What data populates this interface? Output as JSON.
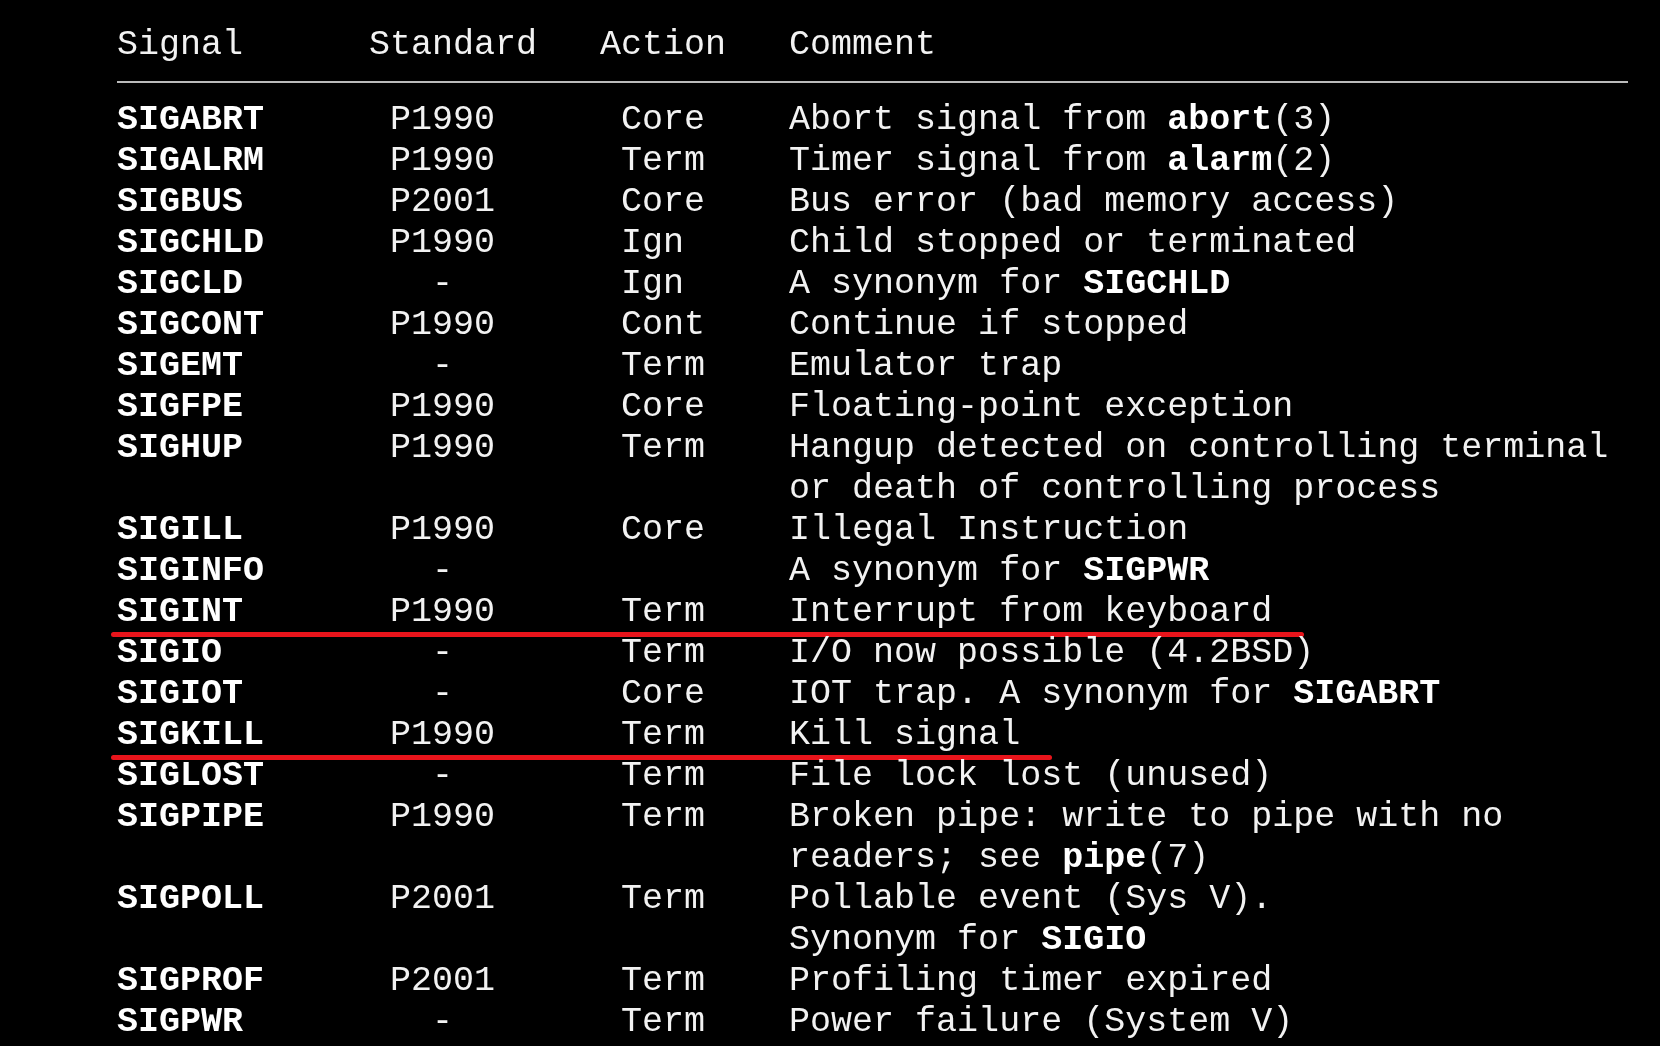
{
  "table": {
    "columns": [
      "Signal",
      "Standard",
      "Action",
      "Comment"
    ],
    "rows": [
      {
        "signal": "SIGABRT",
        "standard": "P1990",
        "action": "Core",
        "comment": [
          "Abort signal from **abort**(3)"
        ],
        "red_underline": false
      },
      {
        "signal": "SIGALRM",
        "standard": "P1990",
        "action": "Term",
        "comment": [
          "Timer signal from **alarm**(2)"
        ],
        "red_underline": false
      },
      {
        "signal": "SIGBUS",
        "standard": "P2001",
        "action": "Core",
        "comment": [
          "Bus error (bad memory access)"
        ],
        "red_underline": false
      },
      {
        "signal": "SIGCHLD",
        "standard": "P1990",
        "action": "Ign",
        "comment": [
          "Child stopped or terminated"
        ],
        "red_underline": false
      },
      {
        "signal": "SIGCLD",
        "standard": "-",
        "action": "Ign",
        "comment": [
          "A synonym for **SIGCHLD**"
        ],
        "red_underline": false
      },
      {
        "signal": "SIGCONT",
        "standard": "P1990",
        "action": "Cont",
        "comment": [
          "Continue if stopped"
        ],
        "red_underline": false
      },
      {
        "signal": "SIGEMT",
        "standard": "-",
        "action": "Term",
        "comment": [
          "Emulator trap"
        ],
        "red_underline": false
      },
      {
        "signal": "SIGFPE",
        "standard": "P1990",
        "action": "Core",
        "comment": [
          "Floating-point exception"
        ],
        "red_underline": false
      },
      {
        "signal": "SIGHUP",
        "standard": "P1990",
        "action": "Term",
        "comment": [
          "Hangup detected on controlling terminal",
          "or death of controlling process"
        ],
        "red_underline": false
      },
      {
        "signal": "SIGILL",
        "standard": "P1990",
        "action": "Core",
        "comment": [
          "Illegal Instruction"
        ],
        "red_underline": false
      },
      {
        "signal": "SIGINFO",
        "standard": "-",
        "action": "",
        "comment": [
          "A synonym for **SIGPWR**"
        ],
        "red_underline": false
      },
      {
        "signal": "SIGINT",
        "standard": "P1990",
        "action": "Term",
        "comment": [
          "Interrupt from keyboard"
        ],
        "red_underline": true
      },
      {
        "signal": "SIGIO",
        "standard": "-",
        "action": "Term",
        "comment": [
          "I/O now possible (4.2BSD)"
        ],
        "red_underline": false
      },
      {
        "signal": "SIGIOT",
        "standard": "-",
        "action": "Core",
        "comment": [
          "IOT trap. A synonym for **SIGABRT**"
        ],
        "red_underline": false
      },
      {
        "signal": "SIGKILL",
        "standard": "P1990",
        "action": "Term",
        "comment": [
          "Kill signal"
        ],
        "red_underline": true
      },
      {
        "signal": "SIGLOST",
        "standard": "-",
        "action": "Term",
        "comment": [
          "File lock lost (unused)"
        ],
        "red_underline": false
      },
      {
        "signal": "SIGPIPE",
        "standard": "P1990",
        "action": "Term",
        "comment": [
          "Broken pipe: write to pipe with no",
          "readers; see **pipe**(7)"
        ],
        "red_underline": false
      },
      {
        "signal": "SIGPOLL",
        "standard": "P2001",
        "action": "Term",
        "comment": [
          "Pollable event (Sys V).",
          "Synonym for **SIGIO**"
        ],
        "red_underline": false
      },
      {
        "signal": "SIGPROF",
        "standard": "P2001",
        "action": "Term",
        "comment": [
          "Profiling timer expired"
        ],
        "red_underline": false
      },
      {
        "signal": "SIGPWR",
        "standard": "-",
        "action": "Term",
        "comment": [
          "Power failure (System V)"
        ],
        "red_underline": false
      }
    ]
  }
}
